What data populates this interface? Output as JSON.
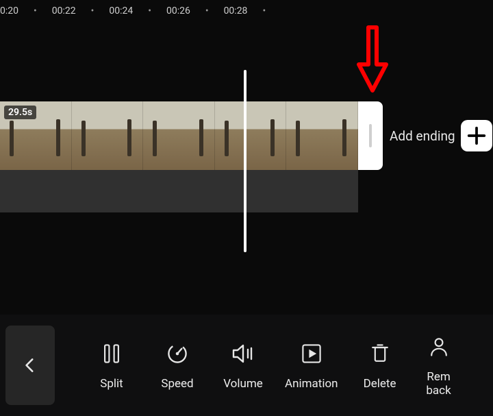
{
  "ruler": {
    "ticks": [
      "0:20",
      "00:22",
      "00:24",
      "00:26",
      "00:28"
    ]
  },
  "clip": {
    "duration_label": "29.5s",
    "thumb_count": 5
  },
  "add_ending": {
    "label": "Add ending"
  },
  "toolbar": {
    "back": "back",
    "items": [
      {
        "id": "split",
        "label": "Split"
      },
      {
        "id": "speed",
        "label": "Speed"
      },
      {
        "id": "volume",
        "label": "Volume"
      },
      {
        "id": "animation",
        "label": "Animation"
      },
      {
        "id": "delete",
        "label": "Delete"
      },
      {
        "id": "remove-bg",
        "label": "Rem\nback"
      }
    ]
  },
  "colors": {
    "bg": "#0a0a0a",
    "accent_arrow": "#ff0000"
  }
}
